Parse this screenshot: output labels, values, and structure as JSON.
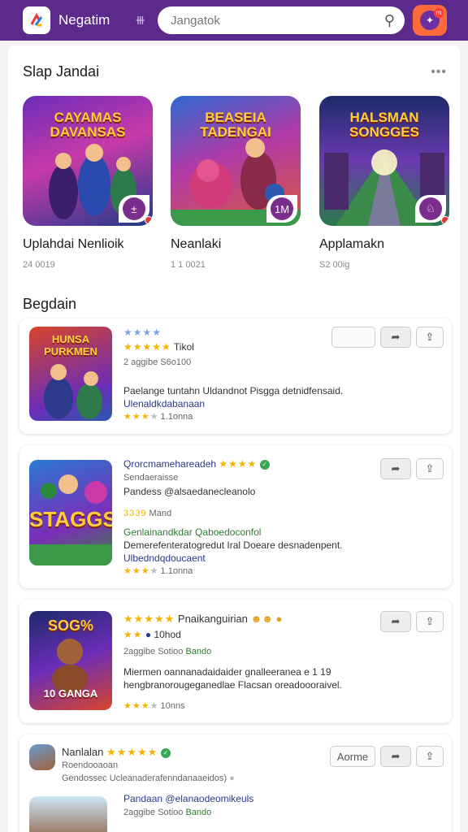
{
  "header": {
    "title": "Negatim",
    "search_placeholder": "Jangatok",
    "badge": "m"
  },
  "featured": {
    "title": "Slap Jandai",
    "items": [
      {
        "art_title": "CAYAMAS DAVANSAS",
        "name": "Uplahdai Nenlioik",
        "meta": "24 0019",
        "badge": "±"
      },
      {
        "art_title": "BEASEIA TADENGAI",
        "name": "Neanlaki",
        "meta": "1 1 0021",
        "badge": "1M"
      },
      {
        "art_title": "HALSMAN SONGGES",
        "name": "Applamakn",
        "meta": "S2 00ig",
        "badge": "♘"
      }
    ]
  },
  "list": {
    "title": "Begdain",
    "cards": [
      {
        "thumb_title": "HUNSA PURKMEN",
        "stars_top": "★★★★",
        "stars_text": "★★★★★",
        "label": "Tikol",
        "sub": "2 aggibe S6o100",
        "desc1": "Paelange tuntahn Uldandnot Pisgga detnidfensaid.",
        "link": "Ulenaldkdabanaan",
        "rating_stars": "★★★",
        "rating_text": "1.1onna",
        "buttons": [
          "",
          "➦",
          "⇪"
        ]
      },
      {
        "thumb_title": "STAGGS",
        "title_link": "Qrorcmamehareadeh",
        "title_stars": "★★★★",
        "sub": "Sendaeraisse",
        "author": "Pandess @alsaedanecleanolo",
        "small_stars": "3339",
        "label": "Mand",
        "green": "Genlainandkdar Qaboedoconfol",
        "desc1": "Demerefenteratogredut Iral Doeare desnadenpent.",
        "link": "Ulbedndqdoucaent",
        "rating_stars": "★★★",
        "rating_text": "1.1onna",
        "buttons": [
          "➦",
          "⇪"
        ]
      },
      {
        "thumb_title": "SOG%",
        "thumb_bottom": "10 GANGA",
        "title_stars": "★★★★★",
        "title": "Pnaikanguirian",
        "small_stars": "★★",
        "sub_num": "10hod",
        "sub": "2aggibe Sotioo",
        "sub_green": "Bando",
        "desc1": "Miermen oannanadaidaider gnalleeranea e 1 19",
        "desc2": "hengbranorougeganedlae Flacsan oreadoooraivel.",
        "rating_stars": "★★★",
        "rating_text": "10nns",
        "buttons": [
          "➦",
          "⇪"
        ]
      },
      {
        "title": "Nanlalan",
        "title_stars": "★★★★★",
        "sub": "Roendooaoan",
        "desc1": "Gendossec Ucleanaderafenndanaaeidos)",
        "author": "Pandaan @elanaodeomikeuls",
        "sub2": "2aggibe Sotioo",
        "sub_green": "Bando",
        "buttons": [
          "Aorme",
          "➦",
          "⇪"
        ]
      }
    ]
  },
  "colors": {
    "header": "#5b2a8a",
    "accent": "#ff6a3d",
    "star": "#f4b400",
    "link": "#2a3a8c"
  }
}
